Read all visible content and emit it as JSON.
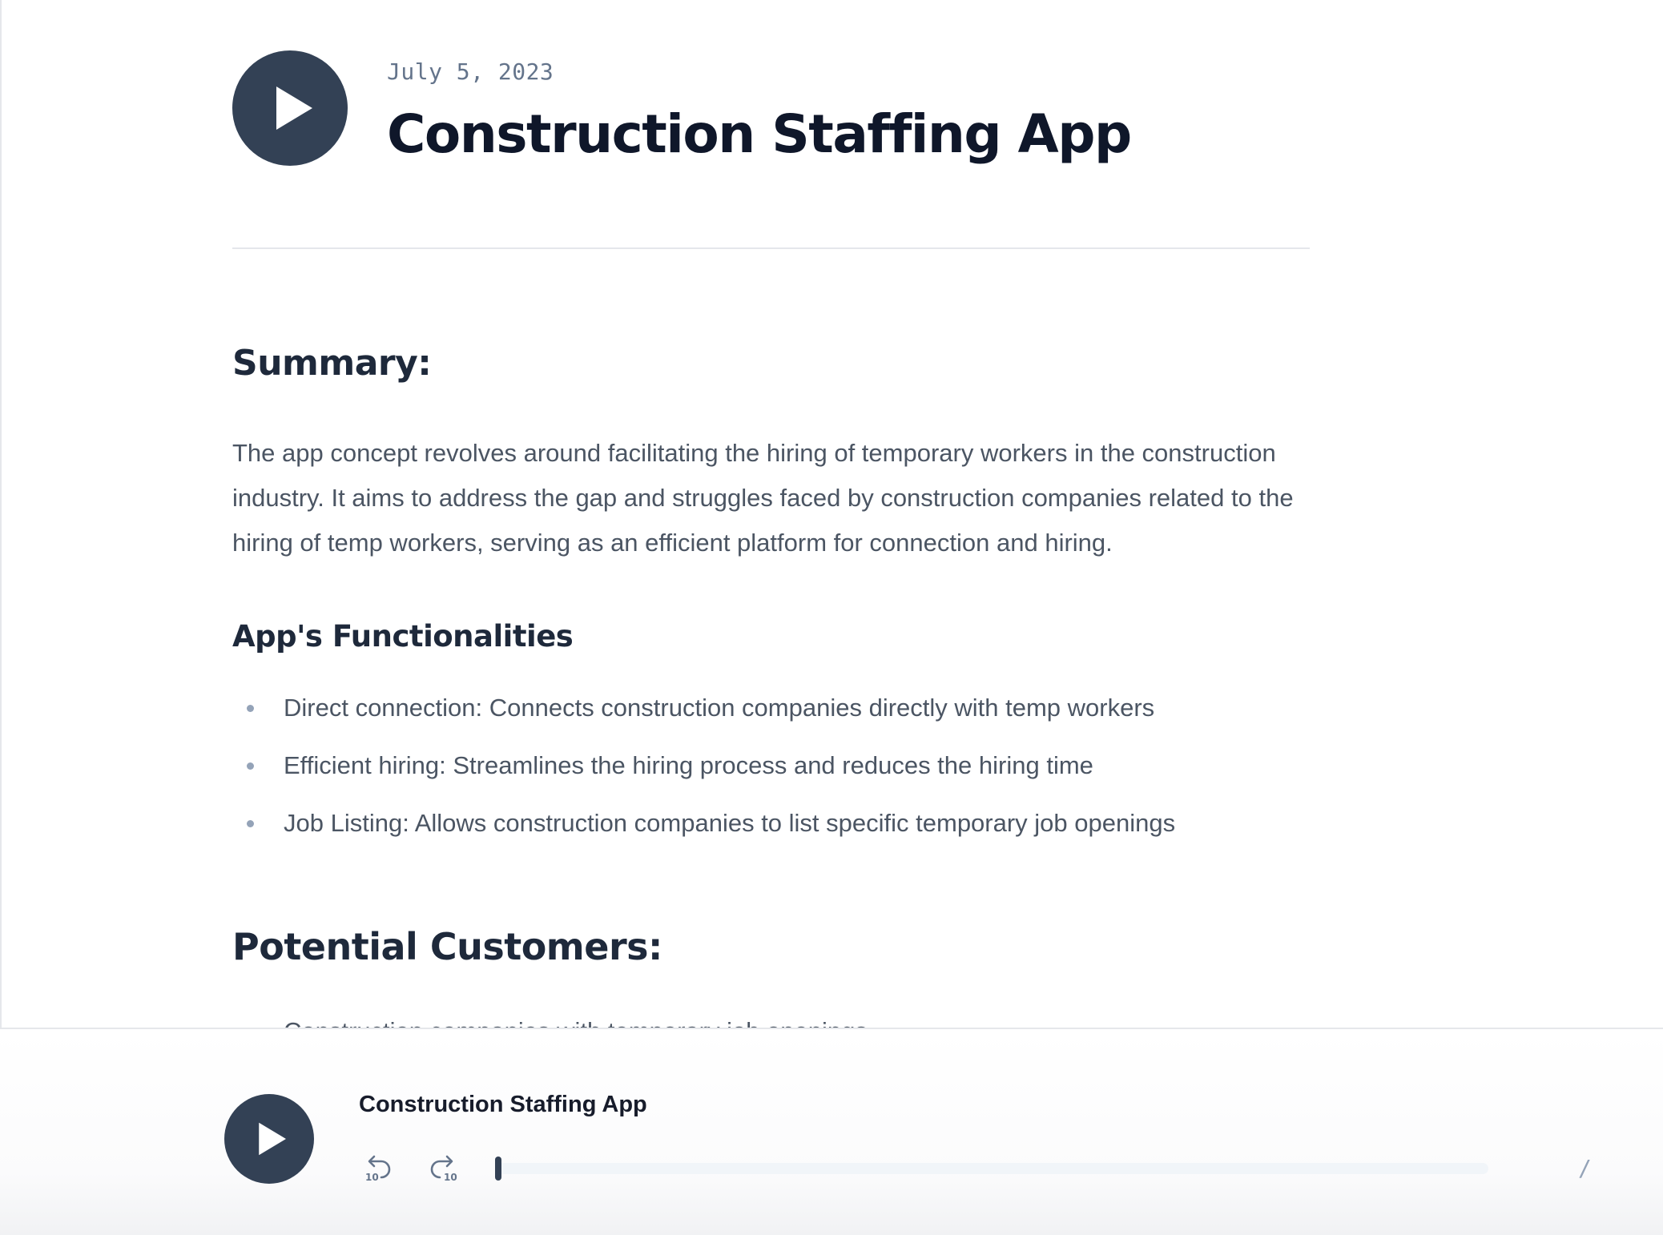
{
  "header": {
    "date": "July 5, 2023",
    "title": "Construction Staffing App",
    "play_icon": "play-icon"
  },
  "summary": {
    "heading": "Summary:",
    "text": "The app concept revolves around facilitating the hiring of temporary workers in the construction industry. It aims to address the gap and struggles faced by construction companies related to the hiring of temp workers, serving as an efficient platform for connection and hiring."
  },
  "functionalities": {
    "heading": "App's Functionalities",
    "items": [
      {
        "text": "Direct connection: Connects construction companies directly with temp workers"
      },
      {
        "text": "Efficient hiring: Streamlines the hiring process and reduces the hiring time"
      },
      {
        "text": "Job Listing: Allows construction companies to list specific temporary job openings"
      }
    ]
  },
  "customers": {
    "heading": "Potential Customers:",
    "items": [
      {
        "text": "Construction companies with temporary job openings"
      }
    ]
  },
  "player": {
    "title": "Construction Staffing App",
    "rewind_icon": "rewind-10-icon",
    "forward_icon": "forward-10-icon",
    "rewind_label": "10",
    "forward_label": "10",
    "progress": 0,
    "time_separator": "/"
  },
  "colors": {
    "accent": "#334155",
    "heading": "#0f172a",
    "body_text": "#4b5563",
    "muted": "#64748b"
  }
}
